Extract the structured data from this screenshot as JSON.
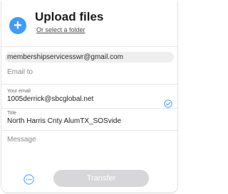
{
  "upload": {
    "title": "Upload files",
    "select_folder": "Or select a folder",
    "icon": "plus-icon"
  },
  "recipient": {
    "chip": "membershipservicesswr@gmail.com"
  },
  "email_to": {
    "placeholder": "Email to"
  },
  "your_email": {
    "label": "Your email",
    "value": "1005derrick@sbcglobal.net",
    "status_icon": "check-circle-icon"
  },
  "title_field": {
    "label": "Title",
    "value": "North Harris Cnty AlumTX_SOSvide"
  },
  "message": {
    "placeholder": "Message"
  },
  "footer": {
    "options_icon": "more-options-icon",
    "transfer_label": "Transfer"
  },
  "colors": {
    "accent": "#409cf8",
    "transfer_disabled": "#d7d7d9"
  }
}
